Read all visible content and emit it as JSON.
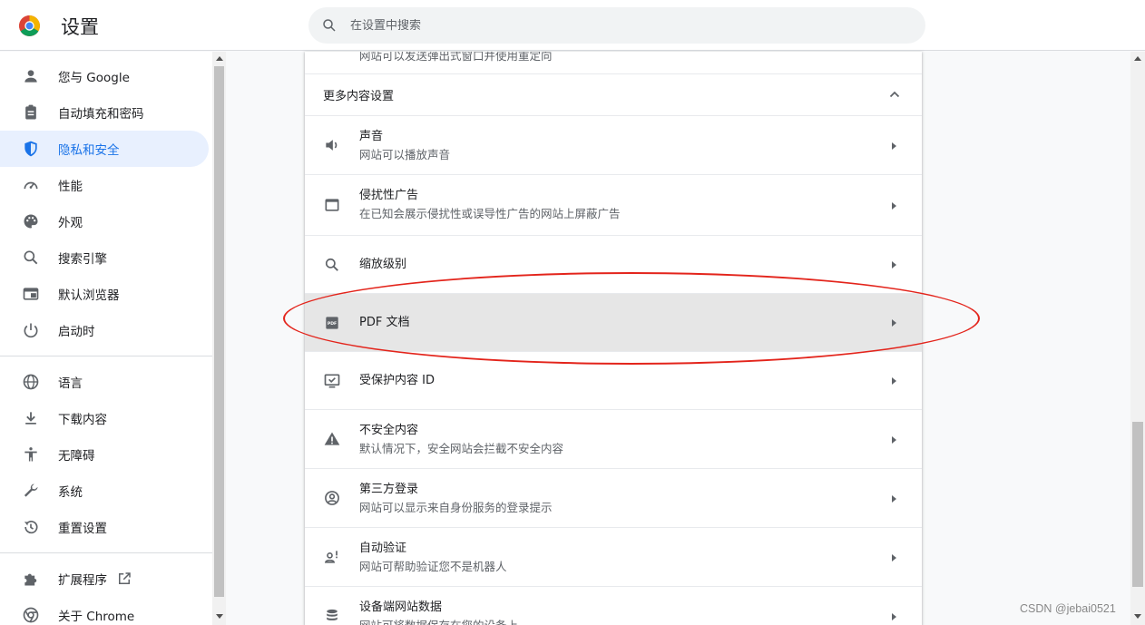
{
  "header": {
    "title": "设置",
    "search_placeholder": "在设置中搜索"
  },
  "sidebar": {
    "items": [
      {
        "label": "您与 Google",
        "icon": "person-icon"
      },
      {
        "label": "自动填充和密码",
        "icon": "clipboard-icon"
      },
      {
        "label": "隐私和安全",
        "icon": "shield-icon",
        "active": true
      },
      {
        "label": "性能",
        "icon": "speedometer-icon"
      },
      {
        "label": "外观",
        "icon": "palette-icon"
      },
      {
        "label": "搜索引擎",
        "icon": "search-icon"
      },
      {
        "label": "默认浏览器",
        "icon": "browser-icon"
      },
      {
        "label": "启动时",
        "icon": "power-icon"
      }
    ],
    "items2": [
      {
        "label": "语言",
        "icon": "globe-icon"
      },
      {
        "label": "下载内容",
        "icon": "download-icon"
      },
      {
        "label": "无障碍",
        "icon": "accessibility-icon"
      },
      {
        "label": "系统",
        "icon": "wrench-icon"
      },
      {
        "label": "重置设置",
        "icon": "restore-icon"
      }
    ],
    "items3": [
      {
        "label": "扩展程序",
        "icon": "puzzle-icon"
      },
      {
        "label": "关于 Chrome",
        "icon": "chrome-icon"
      }
    ]
  },
  "main": {
    "top_partial": "网站可以发送弹出式窗口并使用重定向",
    "section_title": "更多内容设置",
    "rows": [
      {
        "title": "声音",
        "subtitle": "网站可以播放声音",
        "icon": "volume-icon"
      },
      {
        "title": "侵扰性广告",
        "subtitle": "在已知会展示侵扰性或误导性广告的网站上屏蔽广告",
        "icon": "window-icon"
      },
      {
        "title": "缩放级别",
        "subtitle": "",
        "icon": "zoom-icon"
      },
      {
        "title": "PDF 文档",
        "subtitle": "",
        "icon": "pdf-icon",
        "highlighted": true
      },
      {
        "title": "受保护内容 ID",
        "subtitle": "",
        "icon": "protected-content-icon"
      },
      {
        "title": "不安全内容",
        "subtitle": "默认情况下，安全网站会拦截不安全内容",
        "icon": "warning-icon"
      },
      {
        "title": "第三方登录",
        "subtitle": "网站可以显示来自身份服务的登录提示",
        "icon": "account-circle-icon"
      },
      {
        "title": "自动验证",
        "subtitle": "网站可帮助验证您不是机器人",
        "icon": "auto-verify-icon"
      },
      {
        "title": "设备端网站数据",
        "subtitle": "网站可将数据保存在您的设备上",
        "icon": "database-icon"
      }
    ]
  },
  "watermark": "CSDN @jebai0521",
  "colors": {
    "accent": "#1a73e8",
    "annotation": "#e3241b",
    "highlight_row": "#e6e6e6"
  }
}
